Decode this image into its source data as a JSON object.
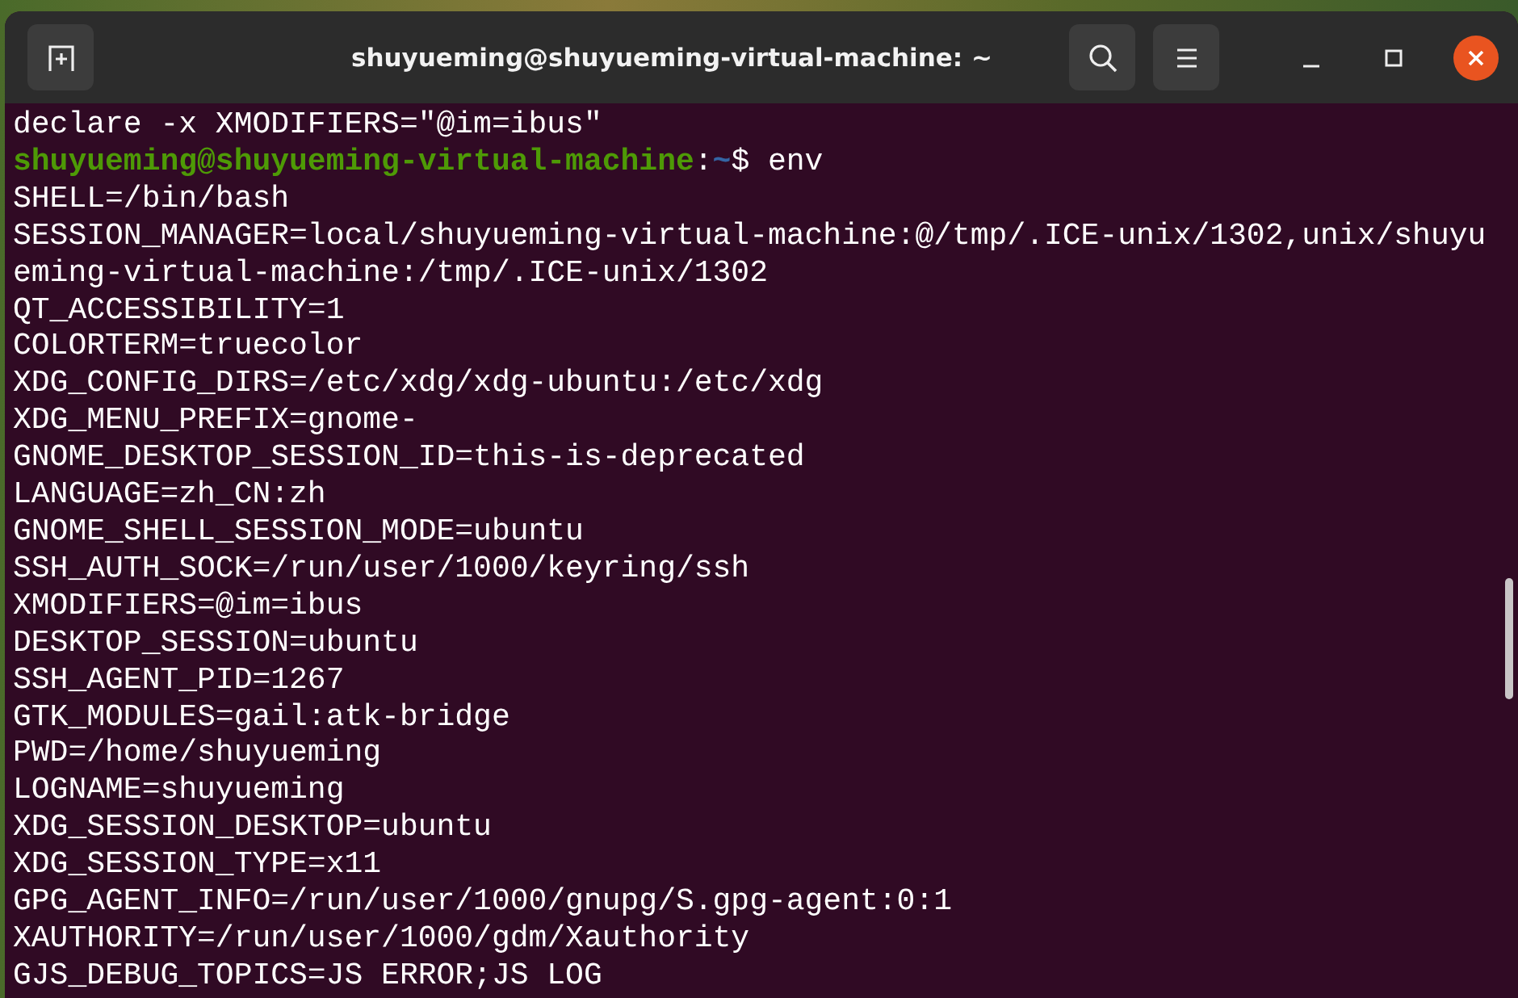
{
  "window": {
    "title": "shuyueming@shuyueming-virtual-machine: ~"
  },
  "terminal": {
    "lines": [
      {
        "kind": "output",
        "text": "declare -x XMODIFIERS=\"@im=ibus\""
      },
      {
        "kind": "prompt",
        "user_host": "shuyueming@shuyueming-virtual-machine",
        "separator": ":",
        "path": "~",
        "symbol": "$",
        "command": "env"
      },
      {
        "kind": "output",
        "text": "SHELL=/bin/bash"
      },
      {
        "kind": "output",
        "text": "SESSION_MANAGER=local/shuyueming-virtual-machine:@/tmp/.ICE-unix/1302,unix/shuyueming-virtual-machine:/tmp/.ICE-unix/1302"
      },
      {
        "kind": "output",
        "text": "QT_ACCESSIBILITY=1"
      },
      {
        "kind": "output",
        "text": "COLORTERM=truecolor"
      },
      {
        "kind": "output",
        "text": "XDG_CONFIG_DIRS=/etc/xdg/xdg-ubuntu:/etc/xdg"
      },
      {
        "kind": "output",
        "text": "XDG_MENU_PREFIX=gnome-"
      },
      {
        "kind": "output",
        "text": "GNOME_DESKTOP_SESSION_ID=this-is-deprecated"
      },
      {
        "kind": "output",
        "text": "LANGUAGE=zh_CN:zh"
      },
      {
        "kind": "output",
        "text": "GNOME_SHELL_SESSION_MODE=ubuntu"
      },
      {
        "kind": "output",
        "text": "SSH_AUTH_SOCK=/run/user/1000/keyring/ssh"
      },
      {
        "kind": "output",
        "text": "XMODIFIERS=@im=ibus"
      },
      {
        "kind": "output",
        "text": "DESKTOP_SESSION=ubuntu"
      },
      {
        "kind": "output",
        "text": "SSH_AGENT_PID=1267"
      },
      {
        "kind": "output",
        "text": "GTK_MODULES=gail:atk-bridge"
      },
      {
        "kind": "output",
        "text": "PWD=/home/shuyueming"
      },
      {
        "kind": "output",
        "text": "LOGNAME=shuyueming"
      },
      {
        "kind": "output",
        "text": "XDG_SESSION_DESKTOP=ubuntu"
      },
      {
        "kind": "output",
        "text": "XDG_SESSION_TYPE=x11"
      },
      {
        "kind": "output",
        "text": "GPG_AGENT_INFO=/run/user/1000/gnupg/S.gpg-agent:0:1"
      },
      {
        "kind": "output",
        "text": "XAUTHORITY=/run/user/1000/gdm/Xauthority"
      },
      {
        "kind": "output",
        "text": "GJS_DEBUG_TOPICS=JS ERROR;JS LOG"
      }
    ]
  }
}
